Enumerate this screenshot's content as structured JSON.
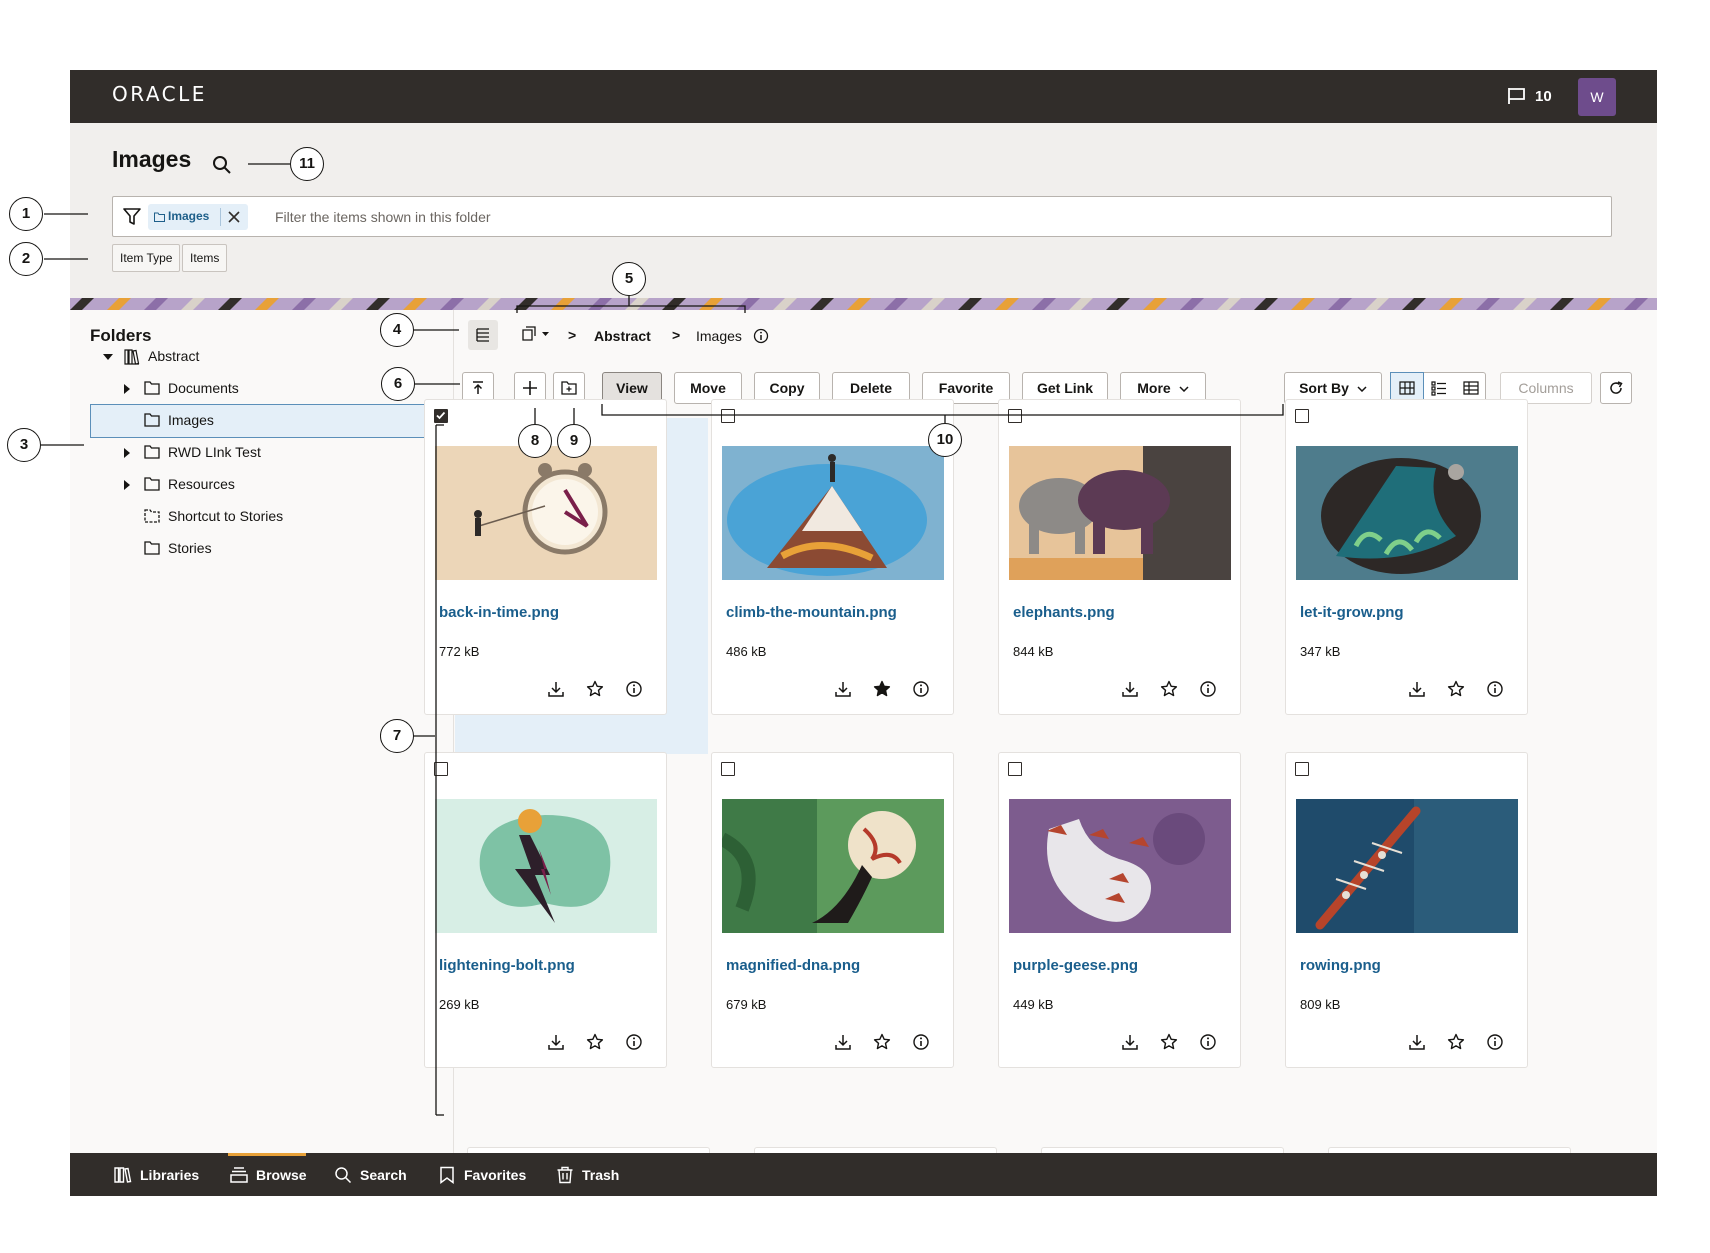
{
  "app": {
    "logo": "ORACLE",
    "notification_count": "10",
    "avatar_initial": "W"
  },
  "page": {
    "title": "Images"
  },
  "filter": {
    "chip_label": "Images",
    "placeholder": "Filter the items shown in this folder",
    "facets": [
      "Item Type",
      "Items"
    ]
  },
  "sidebar": {
    "title": "Folders",
    "items": [
      {
        "label": "Abstract",
        "level": 0,
        "expanded": true,
        "icon": "library-icon"
      },
      {
        "label": "Documents",
        "level": 1,
        "collapsed": true,
        "icon": "folder-icon"
      },
      {
        "label": "Images",
        "level": 1,
        "selected": true,
        "icon": "folder-icon"
      },
      {
        "label": "RWD LInk Test",
        "level": 1,
        "collapsed": true,
        "icon": "folder-icon"
      },
      {
        "label": "Resources",
        "level": 1,
        "collapsed": true,
        "icon": "folder-icon"
      },
      {
        "label": "Shortcut to Stories",
        "level": 1,
        "icon": "folder-shortcut-icon"
      },
      {
        "label": "Stories",
        "level": 1,
        "icon": "folder-icon"
      }
    ]
  },
  "breadcrumb": {
    "separator": ">",
    "items": [
      "Abstract",
      "Images"
    ]
  },
  "toolbar": {
    "view": "View",
    "move": "Move",
    "copy": "Copy",
    "delete": "Delete",
    "favorite": "Favorite",
    "get_link": "Get Link",
    "more": "More",
    "sort_by": "Sort By",
    "columns": "Columns",
    "active_view": "grid"
  },
  "items": [
    {
      "name": "back-in-time.png",
      "size": "772 kB",
      "selected": true,
      "favorite": false
    },
    {
      "name": "climb-the-mountain.png",
      "size": "486 kB",
      "selected": false,
      "favorite": true
    },
    {
      "name": "elephants.png",
      "size": "844 kB",
      "selected": false,
      "favorite": false
    },
    {
      "name": "let-it-grow.png",
      "size": "347 kB",
      "selected": false,
      "favorite": false
    },
    {
      "name": "lightening-bolt.png",
      "size": "269 kB",
      "selected": false,
      "favorite": false
    },
    {
      "name": "magnified-dna.png",
      "size": "679 kB",
      "selected": false,
      "favorite": false
    },
    {
      "name": "purple-geese.png",
      "size": "449 kB",
      "selected": false,
      "favorite": false
    },
    {
      "name": "rowing.png",
      "size": "809 kB",
      "selected": false,
      "favorite": false
    }
  ],
  "bottom_nav": [
    {
      "label": "Libraries",
      "icon": "libraries-icon"
    },
    {
      "label": "Browse",
      "icon": "browse-icon",
      "active": true
    },
    {
      "label": "Search",
      "icon": "search-icon"
    },
    {
      "label": "Favorites",
      "icon": "bookmark-icon"
    },
    {
      "label": "Trash",
      "icon": "trash-icon"
    }
  ],
  "callouts": [
    "1",
    "2",
    "3",
    "4",
    "5",
    "6",
    "7",
    "8",
    "9",
    "10",
    "11"
  ],
  "colors": {
    "topbar": "#312d2a",
    "link": "#1a5e8c",
    "selection": "#e4eff8",
    "accent": "#e8a138",
    "avatar": "#6e4c8c"
  }
}
